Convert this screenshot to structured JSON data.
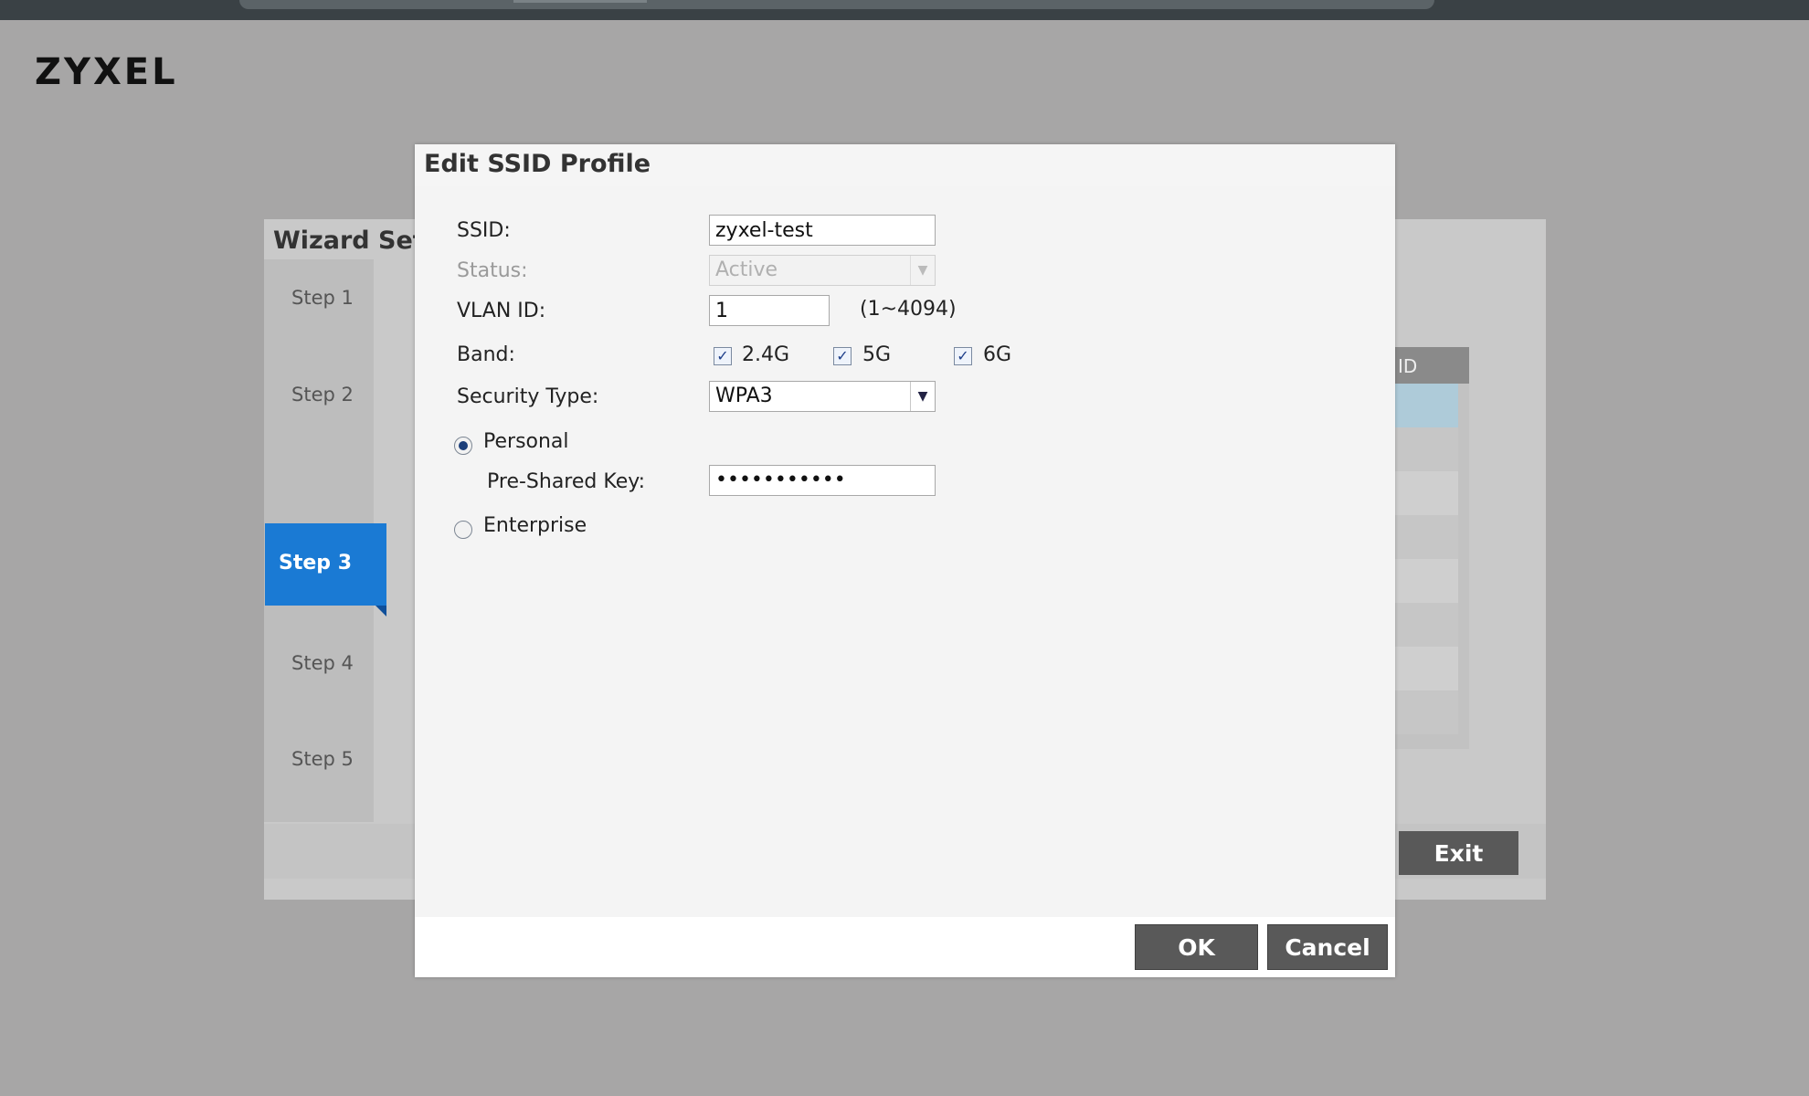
{
  "brand": {
    "logo": "ZYXEL"
  },
  "wizard": {
    "title": "Wizard Sett",
    "steps": [
      "Step 1",
      "Step 2",
      "Step 3",
      "Step 4",
      "Step 5"
    ],
    "active_step": "Step 3",
    "table_header": "ID",
    "exit_label": "Exit"
  },
  "dialog": {
    "title": "Edit SSID Profile",
    "ssid": {
      "label": "SSID:",
      "value": "zyxel-test"
    },
    "status": {
      "label": "Status:",
      "value": "Active",
      "disabled": true
    },
    "vlan": {
      "label": "VLAN ID:",
      "value": "1",
      "hint": "(1~4094)"
    },
    "band": {
      "label": "Band:",
      "options": [
        {
          "label": "2.4G",
          "checked": true
        },
        {
          "label": "5G",
          "checked": true
        },
        {
          "label": "6G",
          "checked": true
        }
      ]
    },
    "security": {
      "label": "Security Type:",
      "value": "WPA3"
    },
    "auth_modes": [
      {
        "label": "Personal",
        "checked": true
      },
      {
        "label": "Enterprise",
        "checked": false
      }
    ],
    "psk": {
      "label": "Pre-Shared Key:",
      "value": "•••••••••••"
    },
    "ok_label": "OK",
    "cancel_label": "Cancel"
  },
  "colors": {
    "overlay": "#a7a6a6",
    "active_step": "#1a7ad4",
    "button": "#595959",
    "selected_row": "#aecbd9"
  },
  "icons": {
    "checkbox": "checkmark-icon",
    "dropdown": "chevron-down-icon",
    "radio": "radio-dot-icon"
  }
}
